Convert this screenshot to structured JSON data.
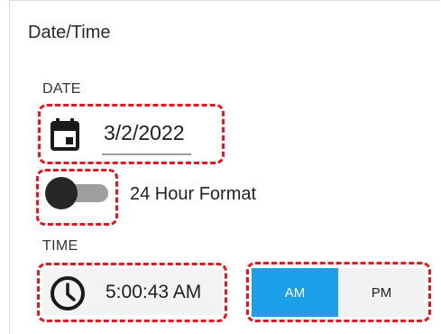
{
  "section_title": "Date/Time",
  "date": {
    "label": "DATE",
    "value": "3/2/2022",
    "icon": "calendar-icon"
  },
  "hour_format": {
    "label": "24 Hour Format",
    "enabled": false
  },
  "time": {
    "label": "TIME",
    "value": "5:00:43 AM",
    "icon": "clock-icon"
  },
  "period": {
    "options": [
      "AM",
      "PM"
    ],
    "selected": "AM"
  },
  "colors": {
    "accent": "#1a9fe8",
    "highlight_border": "#e8141f"
  }
}
